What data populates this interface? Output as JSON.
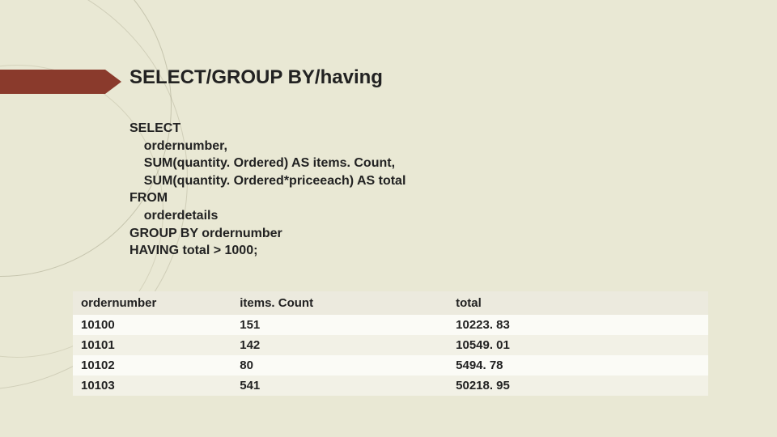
{
  "title": "SELECT/GROUP BY/having",
  "code": "SELECT\n    ordernumber,\n    SUM(quantity. Ordered) AS items. Count,\n    SUM(quantity. Ordered*priceeach) AS total\nFROM\n    orderdetails\nGROUP BY ordernumber\nHAVING total > 1000;",
  "table": {
    "headers": [
      "ordernumber",
      "items. Count",
      "total"
    ],
    "rows": [
      [
        "10100",
        "151",
        "10223. 83"
      ],
      [
        "10101",
        "142",
        "10549. 01"
      ],
      [
        "10102",
        "80",
        "5494. 78"
      ],
      [
        "10103",
        "541",
        "50218. 95"
      ]
    ]
  },
  "chart_data": {
    "type": "table",
    "columns": [
      "ordernumber",
      "items. Count",
      "total"
    ],
    "rows": [
      [
        "10100",
        151,
        10223.83
      ],
      [
        "10101",
        142,
        10549.01
      ],
      [
        "10102",
        80,
        5494.78
      ],
      [
        "10103",
        541,
        50218.95
      ]
    ],
    "title": "SELECT/GROUP BY/having"
  }
}
